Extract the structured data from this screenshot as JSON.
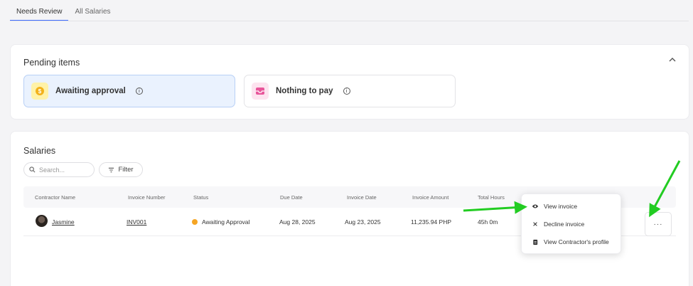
{
  "tabs": [
    {
      "label": "Needs Review",
      "active": true
    },
    {
      "label": "All Salaries",
      "active": false
    }
  ],
  "pending": {
    "title": "Pending items",
    "collapse_icon": "chevron-up-icon",
    "tiles": [
      {
        "label": "Awaiting approval",
        "icon": "coin-icon"
      },
      {
        "label": "Nothing to pay",
        "icon": "inbox-icon"
      }
    ]
  },
  "salaries": {
    "title": "Salaries",
    "search": {
      "placeholder": "Search...",
      "value": ""
    },
    "filter_label": "Filter",
    "columns": [
      "Contractor Name",
      "Invoice Number",
      "Status",
      "Due Date",
      "Invoice Date",
      "Invoice Amount",
      "Total Hours"
    ],
    "rows": [
      {
        "name": "Jasmine",
        "invoice_number": "INV001",
        "status": "Awaiting Approval",
        "due_date": "Aug 28, 2025",
        "invoice_date": "Aug 23, 2025",
        "amount": "11,235.94 PHP",
        "hours": "45h 0m",
        "more_label": "···"
      }
    ]
  },
  "menu": {
    "items": [
      {
        "label": "View invoice",
        "icon": "eye-icon"
      },
      {
        "label": "Decline invoice",
        "icon": "close-icon"
      },
      {
        "label": "View Contractor's profile",
        "icon": "document-icon"
      }
    ]
  },
  "colors": {
    "accent": "#3d6bff",
    "status_pending": "#f5a524",
    "arrow": "#22cc22"
  }
}
